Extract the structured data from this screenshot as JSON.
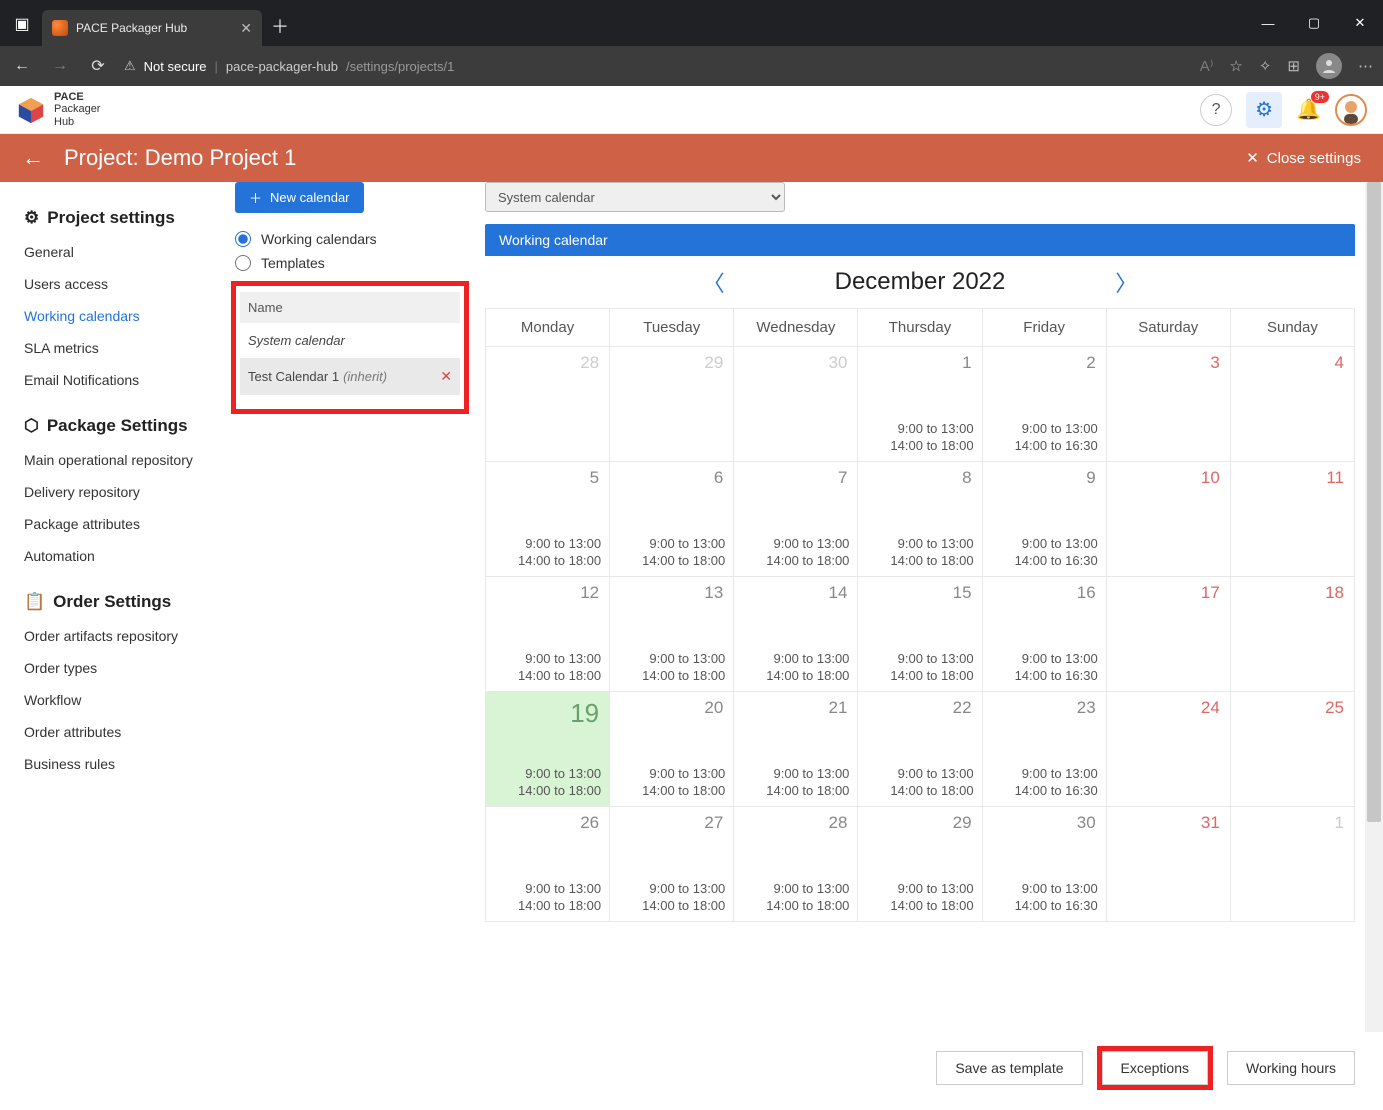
{
  "browser": {
    "tab_title": "PACE Packager Hub",
    "url_secure_text": "Not secure",
    "url_host": "pace-packager-hub",
    "url_path": "/settings/projects/1"
  },
  "app": {
    "logo_line1": "PACE",
    "logo_line2": "Packager",
    "logo_line3": "Hub",
    "notif_badge": "9+"
  },
  "project_bar": {
    "title": "Project: Demo Project 1",
    "close_label": "Close settings"
  },
  "sidebar": {
    "g1_title": "Project settings",
    "g1_items": [
      "General",
      "Users access",
      "Working calendars",
      "SLA metrics",
      "Email Notifications"
    ],
    "g1_active_index": 2,
    "g2_title": "Package Settings",
    "g2_items": [
      "Main operational repository",
      "Delivery repository",
      "Package attributes",
      "Automation"
    ],
    "g3_title": "Order Settings",
    "g3_items": [
      "Order artifacts repository",
      "Order types",
      "Workflow",
      "Order attributes",
      "Business rules"
    ]
  },
  "mid": {
    "new_btn": "New calendar",
    "radio_working": "Working calendars",
    "radio_templates": "Templates",
    "col_name": "Name",
    "row_system": "System calendar",
    "row_test": "Test Calendar 1",
    "row_test_suffix": "(inherit)"
  },
  "calendar": {
    "select_value": "System calendar",
    "panel_title": "Working calendar",
    "month": "December 2022",
    "dow": [
      "Monday",
      "Tuesday",
      "Wednesday",
      "Thursday",
      "Friday",
      "Saturday",
      "Sunday"
    ],
    "pattern_a": [
      "9:00 to 13:00",
      "14:00 to 18:00"
    ],
    "pattern_b": [
      "9:00 to 13:00",
      "14:00 to 16:30"
    ],
    "weeks": [
      [
        {
          "n": "28",
          "dim": true
        },
        {
          "n": "29",
          "dim": true
        },
        {
          "n": "30",
          "dim": true
        },
        {
          "n": "1",
          "h": "a"
        },
        {
          "n": "2",
          "h": "b"
        },
        {
          "n": "3",
          "wk": true
        },
        {
          "n": "4",
          "wk": true
        }
      ],
      [
        {
          "n": "5",
          "h": "a"
        },
        {
          "n": "6",
          "h": "a"
        },
        {
          "n": "7",
          "h": "a"
        },
        {
          "n": "8",
          "h": "a"
        },
        {
          "n": "9",
          "h": "b"
        },
        {
          "n": "10",
          "wk": true
        },
        {
          "n": "11",
          "wk": true
        }
      ],
      [
        {
          "n": "12",
          "h": "a"
        },
        {
          "n": "13",
          "h": "a"
        },
        {
          "n": "14",
          "h": "a"
        },
        {
          "n": "15",
          "h": "a"
        },
        {
          "n": "16",
          "h": "b"
        },
        {
          "n": "17",
          "wk": true
        },
        {
          "n": "18",
          "wk": true
        }
      ],
      [
        {
          "n": "19",
          "today": true,
          "h": "a"
        },
        {
          "n": "20",
          "h": "a"
        },
        {
          "n": "21",
          "h": "a"
        },
        {
          "n": "22",
          "h": "a"
        },
        {
          "n": "23",
          "h": "b"
        },
        {
          "n": "24",
          "wk": true
        },
        {
          "n": "25",
          "wk": true
        }
      ],
      [
        {
          "n": "26",
          "h": "a"
        },
        {
          "n": "27",
          "h": "a"
        },
        {
          "n": "28",
          "h": "a"
        },
        {
          "n": "29",
          "h": "a"
        },
        {
          "n": "30",
          "h": "b"
        },
        {
          "n": "31",
          "wk": true
        },
        {
          "n": "1",
          "dim": true
        }
      ]
    ]
  },
  "footer": {
    "save_tpl": "Save as template",
    "exceptions": "Exceptions",
    "working_hours": "Working hours"
  }
}
